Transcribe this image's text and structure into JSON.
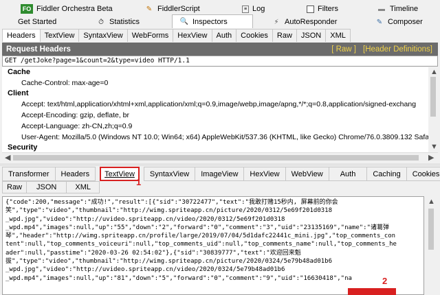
{
  "top_tabs_row1": [
    {
      "label": "Fiddler Orchestra Beta",
      "icon": "fo-badge"
    },
    {
      "label": "FiddlerScript",
      "icon": "script-icon"
    },
    {
      "label": "Log",
      "icon": "log-icon"
    },
    {
      "label": "Filters",
      "icon": "checkbox-icon"
    },
    {
      "label": "Timeline",
      "icon": "timeline-icon"
    }
  ],
  "fo_badge_text": "FO",
  "top_tabs_row2": [
    {
      "label": "Get Started"
    },
    {
      "label": "Statistics",
      "icon": "stopwatch-icon"
    },
    {
      "label": "Inspectors",
      "icon": "inspect-icon"
    },
    {
      "label": "AutoResponder",
      "icon": "lightning-icon"
    },
    {
      "label": "Composer",
      "icon": "compose-icon"
    }
  ],
  "request_tabs": [
    "Headers",
    "TextView",
    "SyntaxView",
    "WebForms",
    "HexView",
    "Auth",
    "Cookies",
    "Raw",
    "JSON",
    "XML"
  ],
  "request_header": {
    "title": "Request Headers",
    "raw_link": "[ Raw ]",
    "defs_link": "[Header Definitions]",
    "request_line": "GET /getJoke?page=1&count=2&type=video HTTP/1.1"
  },
  "header_groups": {
    "cache_label": "Cache",
    "cache_control": "Cache-Control: max-age=0",
    "client_label": "Client",
    "accept": "Accept: text/html,application/xhtml+xml,application/xml;q=0.9,image/webp,image/apng,*/*;q=0.8,application/signed-exchang",
    "accept_encoding": "Accept-Encoding: gzip, deflate, br",
    "accept_language": "Accept-Language: zh-CN,zh;q=0.9",
    "user_agent": "User-Agent: Mozilla/5.0 (Windows NT 10.0; Win64; x64) AppleWebKit/537.36 (KHTML, like Gecko) Chrome/76.0.3809.132 Safar",
    "security_label": "Security"
  },
  "response_tabs_row1": [
    "Transformer",
    "Headers",
    "TextView",
    "SyntaxView",
    "ImageView",
    "HexView",
    "WebView",
    "Auth",
    "Caching",
    "Cookies"
  ],
  "response_tabs_row2": [
    "Raw",
    "JSON",
    "XML"
  ],
  "annotation_1": "1",
  "annotation_2": "2",
  "response_lines": [
    "{\"code\":200,\"message\":\"成功!\",\"result\":[{\"sid\":\"30722477\",\"text\":\"我敢打赌15秒内, 屏幕前的你会",
    "笑\",\"type\":\"video\",\"thumbnail\":\"http://wimg.spriteapp.cn/picture/2020/0312/5e69f201d0318",
    "_wpd.jpg\",\"video\":\"http://uvideo.spriteapp.cn/video/2020/0312/5e69f201d0318",
    "_wpd.mp4\",\"images\":null,\"up\":\"55\",\"down\":\"2\",\"forward\":\"0\",\"comment\":\"3\",\"uid\":\"23135169\",\"name\":\"诸葛弹",
    "琴\",\"header\":\"http://wimg.spriteapp.cn/profile/large/2019/07/04/5d1dafc22441c_mini.jpg\",\"top_comments_con",
    "tent\":null,\"top_comments_voiceuri\":null,\"top_comments_uid\":null,\"top_comments_name\":null,\"top_comments_he",
    "ader\":null,\"passtime\":\"2020-03-26 02:54:02\"},{\"sid\":\"30839777\",\"text\":\"欢迎回来魁",
    "拔\",\"type\":\"video\",\"thumbnail\":\"http://wimg.spriteapp.cn/picture/2020/0324/5e79b48ad01b6",
    "_wpd.jpg\",\"video\":\"http://uvideo.spriteapp.cn/video/2020/0324/5e79b48ad01b6",
    "_wpd.mp4\",\"images\":null,\"up\":\"81\",\"down\":\"5\",\"forward\":\"0\",\"comment\":\"9\",\"uid\":\"16630418\",\"na"
  ]
}
